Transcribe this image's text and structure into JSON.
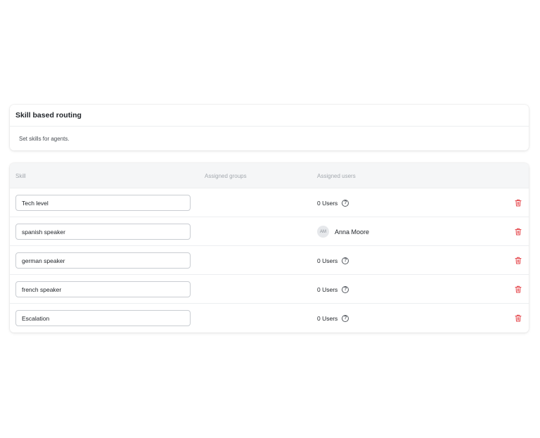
{
  "header": {
    "title": "Skill based routing",
    "description": "Set skills for agents."
  },
  "table": {
    "columns": {
      "skill": "Skill",
      "groups": "Assigned groups",
      "users": "Assigned users"
    },
    "rows": [
      {
        "skill": "Tech level",
        "groups": "",
        "users_text": "0 Users",
        "assigned_user": null
      },
      {
        "skill": "spanish speaker",
        "groups": "",
        "users_text": "",
        "assigned_user": {
          "initials": "AM",
          "name": "Anna Moore"
        }
      },
      {
        "skill": "german speaker",
        "groups": "",
        "users_text": "0 Users",
        "assigned_user": null
      },
      {
        "skill": "french speaker",
        "groups": "",
        "users_text": "0 Users",
        "assigned_user": null
      },
      {
        "skill": "Escalation",
        "groups": "",
        "users_text": "0 Users",
        "assigned_user": null
      }
    ]
  },
  "icons": {
    "help": "question-circle-icon",
    "delete": "trash-icon"
  },
  "colors": {
    "delete": "#e5484d",
    "header_bg": "#f5f6f7",
    "muted_text": "#a3a8ae"
  }
}
